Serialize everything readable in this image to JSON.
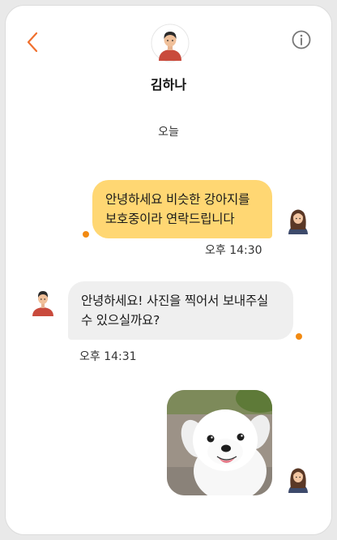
{
  "header": {
    "contact_name": "김하나"
  },
  "date_separator": "오늘",
  "messages": [
    {
      "direction": "sent",
      "text": "안녕하세요 비슷한 강아지를 보호중이라 연락드립니다",
      "time": "오후 14:30",
      "unread": true
    },
    {
      "direction": "received",
      "text": "안녕하세요! 사진을 찍어서 보내주실 수 있으실까요?",
      "time": "오후 14:31",
      "unread": true
    },
    {
      "direction": "sent",
      "type": "image",
      "image_subject": "white fluffy puppy",
      "unread": false
    }
  ],
  "icons": {
    "back": "chevron-left-icon",
    "info": "info-icon"
  },
  "colors": {
    "accent": "#f0702e",
    "sent_bubble": "#ffd773",
    "received_bubble": "#efefef",
    "unread_dot": "#f28a12"
  }
}
